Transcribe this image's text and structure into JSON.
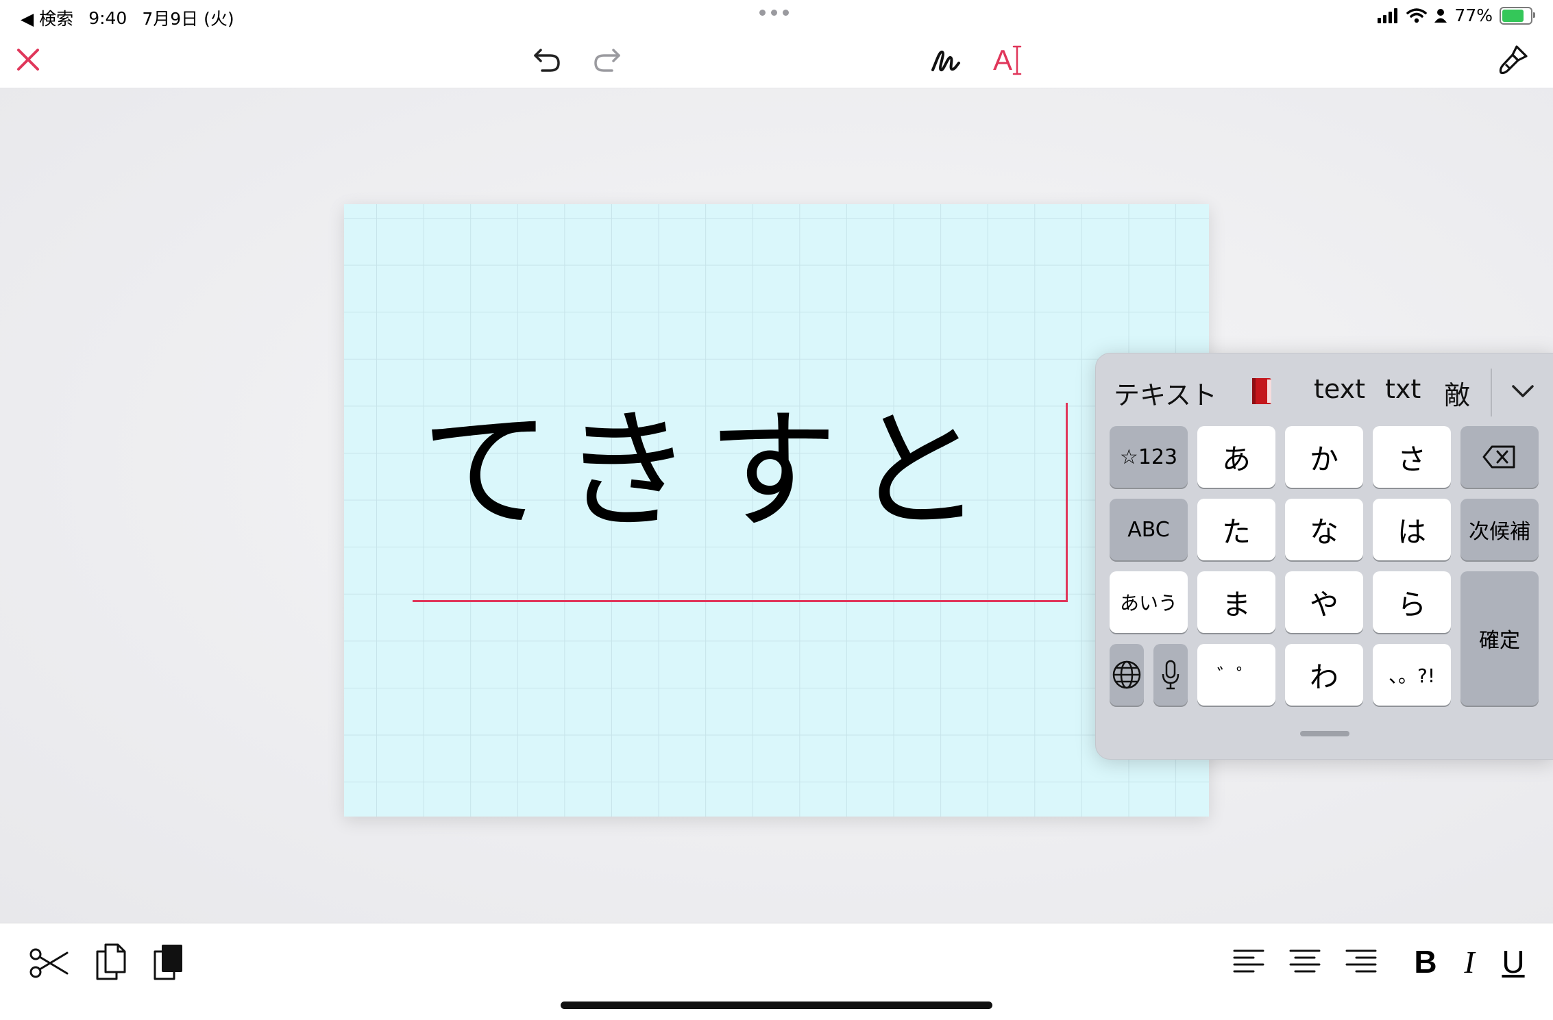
{
  "status_bar": {
    "back_label": "◀ 検索",
    "time": "9:40",
    "date": "7月9日 (火)",
    "battery_text": "77%",
    "battery_level": 0.77
  },
  "toolbar": {
    "close_icon": "close-icon",
    "undo_icon": "undo-icon",
    "redo_icon": "redo-icon",
    "handwriting_icon": "handwriting-icon",
    "text_mode_label": "A",
    "brush_icon": "brush-icon",
    "accent_color": "#e0365a"
  },
  "canvas": {
    "text": "てきすと",
    "card_color": "#daf7fb"
  },
  "keyboard": {
    "candidates": [
      "テキスト",
      "📕",
      "text",
      "txt",
      "敵"
    ],
    "keys": {
      "num": "☆123",
      "a": "あ",
      "ka": "か",
      "sa": "さ",
      "abc": "ABC",
      "ta": "た",
      "na": "な",
      "ha": "は",
      "next": "次候補",
      "aiu": "あいう",
      "ma": "ま",
      "ya": "や",
      "ra": "ら",
      "confirm": "確定",
      "dakuten": "゛゜",
      "wa": "わ",
      "punct": "、。?!"
    }
  },
  "bottom_toolbar": {
    "bold_label": "B",
    "italic_label": "I",
    "underline_label": "U"
  }
}
